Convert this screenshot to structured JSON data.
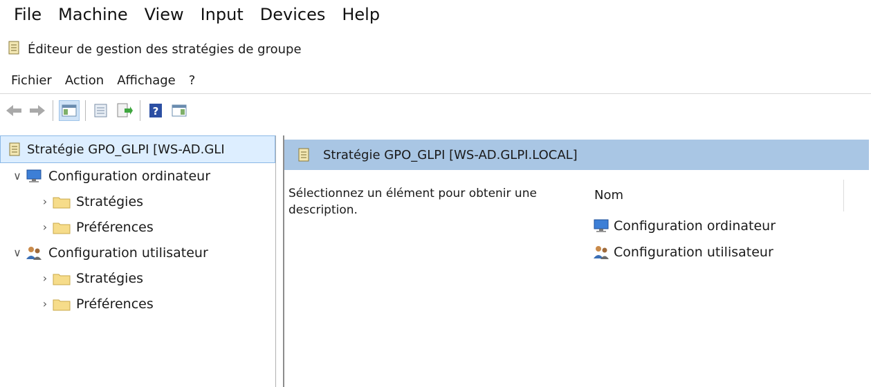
{
  "vbox_menu": [
    "File",
    "Machine",
    "View",
    "Input",
    "Devices",
    "Help"
  ],
  "window": {
    "title": "Éditeur de gestion des stratégies de groupe",
    "icon": "policy-icon"
  },
  "menu": [
    "Fichier",
    "Action",
    "Affichage",
    "?"
  ],
  "toolbar": {
    "buttons": [
      "back-arrow-icon",
      "forward-arrow-icon",
      "show-hide-console-tree-icon",
      "properties-icon",
      "export-list-icon",
      "help-icon",
      "show-action-pane-icon"
    ]
  },
  "tree": {
    "root": "Stratégie GPO_GLPI [WS-AD.GLI",
    "computer": {
      "label": "Configuration ordinateur",
      "children": [
        "Stratégies",
        "Préférences"
      ]
    },
    "user": {
      "label": "Configuration utilisateur",
      "children": [
        "Stratégies",
        "Préférences"
      ]
    }
  },
  "details": {
    "header": "Stratégie GPO_GLPI [WS-AD.GLPI.LOCAL]",
    "description": "Sélectionnez un élément pour obtenir une description.",
    "column": "Nom",
    "items": [
      "Configuration ordinateur",
      "Configuration utilisateur"
    ]
  }
}
